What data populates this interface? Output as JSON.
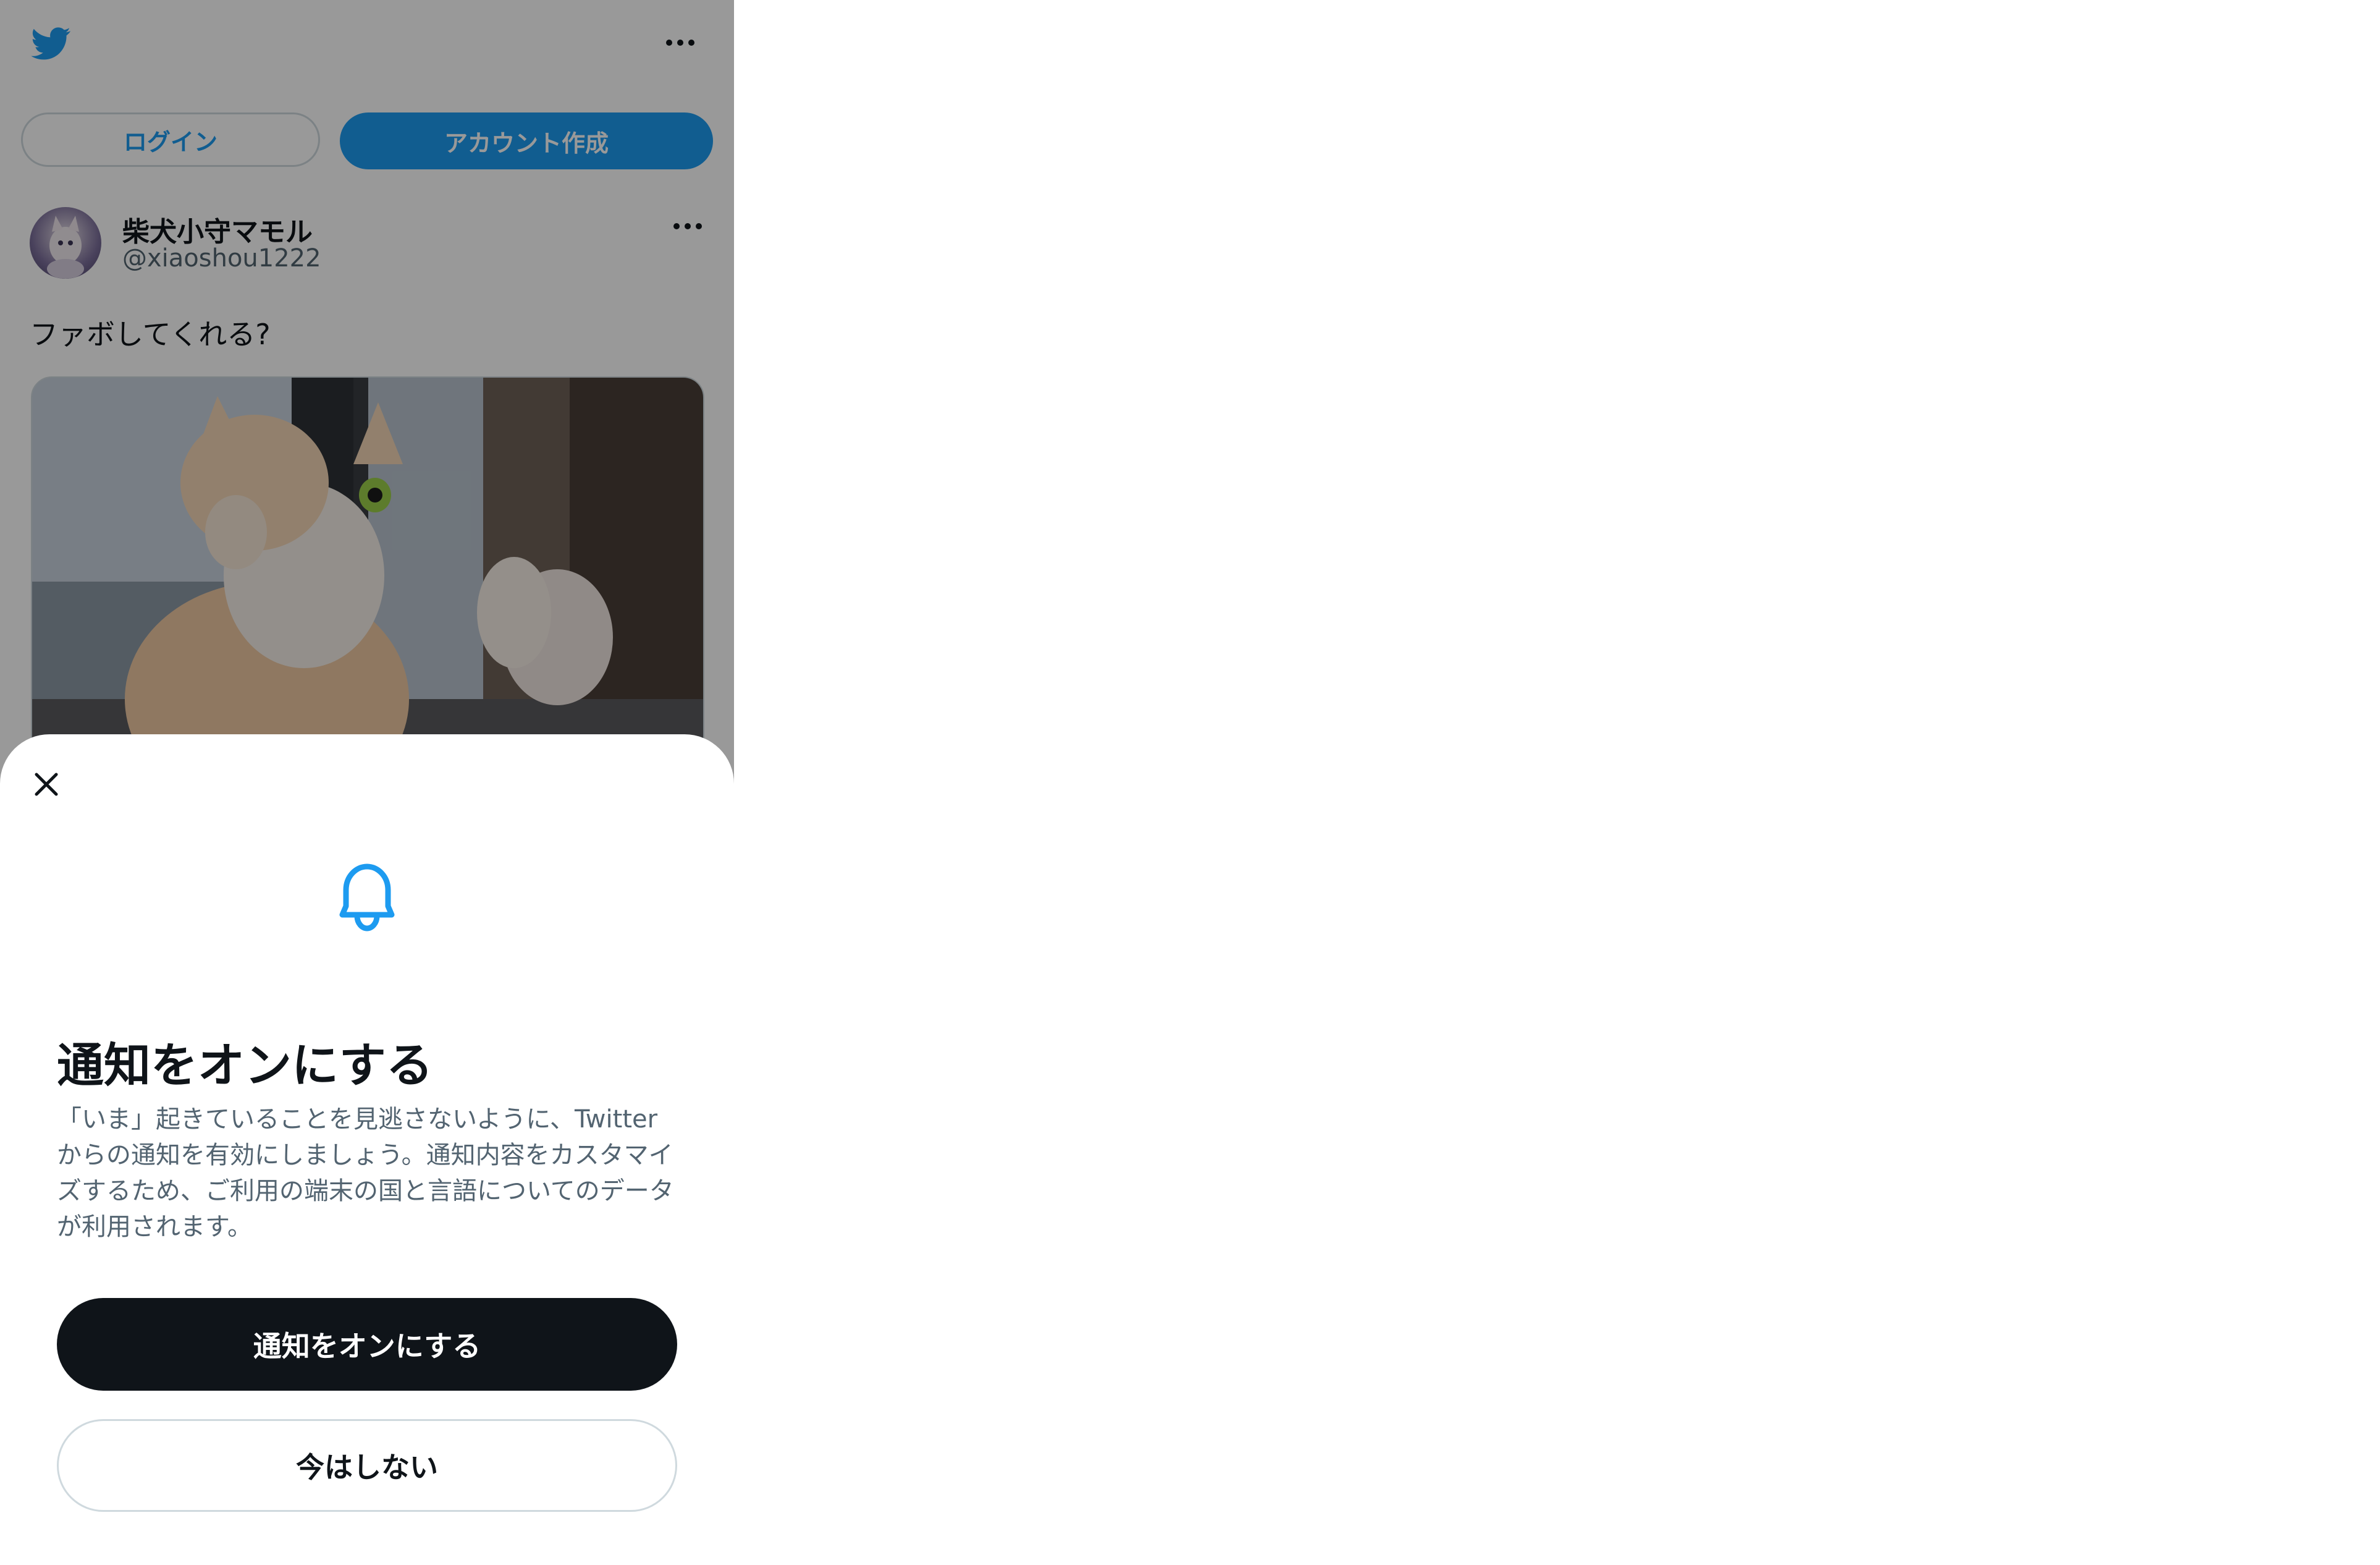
{
  "header": {
    "logo_icon": "twitter-bird-icon",
    "more_icon": "more-horizontal-icon"
  },
  "auth": {
    "login_label": "ログイン",
    "signup_label": "アカウント作成"
  },
  "tweet": {
    "author_name": "柴犬小守マモル",
    "author_handle": "@xiaoshou1222",
    "text": "ファボしてくれる?",
    "more_icon": "more-horizontal-icon"
  },
  "sheet": {
    "close_icon": "close-icon",
    "bell_icon": "bell-icon",
    "title": "通知をオンにする",
    "body": "「いま」起きていることを見逃さないように、Twitterからの通知を有効にしましょう。通知内容をカスタマイズするため、ご利用の端末の国と言語についてのデータが利用されます。",
    "enable_label": "通知をオンにする",
    "later_label": "今はしない"
  },
  "colors": {
    "brand": "#1d9bf0",
    "text": "#0f1419",
    "secondary": "#536471"
  }
}
